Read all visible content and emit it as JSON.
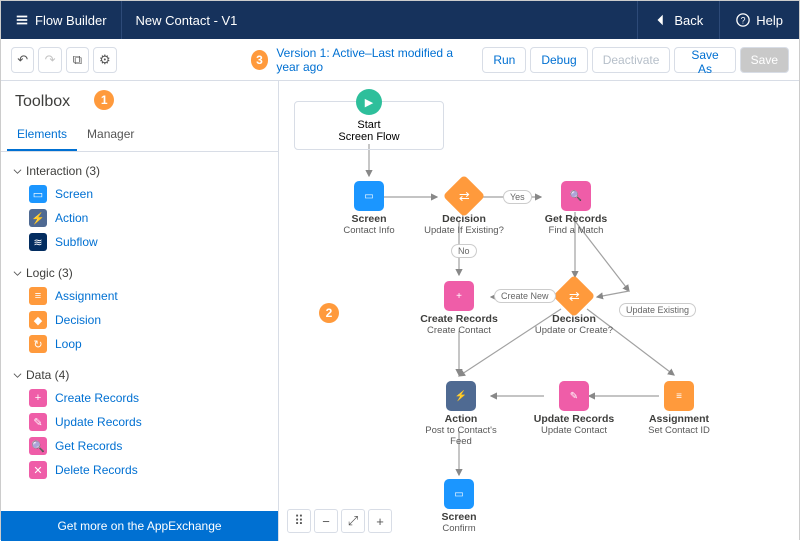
{
  "header": {
    "app_name": "Flow Builder",
    "flow_title": "New Contact - V1",
    "back": "Back",
    "help": "Help"
  },
  "toolbar": {
    "version_text": "Version 1: Active–Last modified a year ago",
    "run": "Run",
    "debug": "Debug",
    "deactivate": "Deactivate",
    "save_as": "Save As",
    "save": "Save"
  },
  "toolbox": {
    "title": "Toolbox",
    "tabs": {
      "elements": "Elements",
      "manager": "Manager"
    },
    "groups": {
      "interaction": {
        "label": "Interaction (3)",
        "items": [
          "Screen",
          "Action",
          "Subflow"
        ]
      },
      "logic": {
        "label": "Logic (3)",
        "items": [
          "Assignment",
          "Decision",
          "Loop"
        ]
      },
      "data": {
        "label": "Data (4)",
        "items": [
          "Create Records",
          "Update Records",
          "Get Records",
          "Delete Records"
        ]
      }
    },
    "bottom": "Get more on the AppExchange"
  },
  "markers": {
    "m1": "1",
    "m2": "2",
    "m3": "3"
  },
  "canvas": {
    "start": {
      "title": "Start",
      "sub": "Screen Flow"
    },
    "screen_contact": {
      "title": "Screen",
      "sub": "Contact Info"
    },
    "decision_update": {
      "title": "Decision",
      "sub": "Update If Existing?"
    },
    "get_records": {
      "title": "Get Records",
      "sub": "Find a Match"
    },
    "create_records": {
      "title": "Create Records",
      "sub": "Create Contact"
    },
    "decision_uoc": {
      "title": "Decision",
      "sub": "Update or Create?"
    },
    "action_post": {
      "title": "Action",
      "sub": "Post to Contact's Feed"
    },
    "update_records": {
      "title": "Update Records",
      "sub": "Update Contact"
    },
    "assignment": {
      "title": "Assignment",
      "sub": "Set Contact ID"
    },
    "screen_confirm": {
      "title": "Screen",
      "sub": "Confirm"
    },
    "pills": {
      "yes": "Yes",
      "no": "No",
      "create_new": "Create New",
      "update_existing": "Update Existing"
    }
  }
}
